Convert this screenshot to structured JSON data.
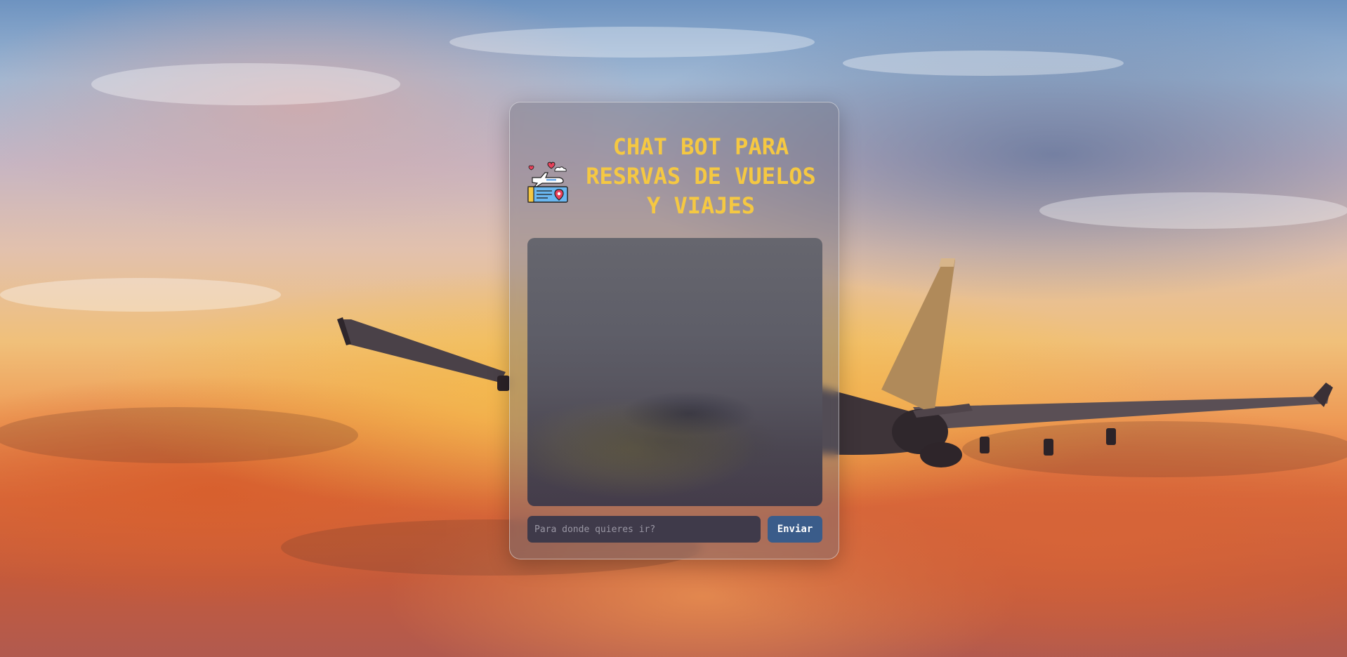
{
  "page": {
    "background": "sunset-sky-with-airplane",
    "accent_color": "#f5c842",
    "button_color": "#3a5c8a"
  },
  "header": {
    "logo_icon": "flight-ticket-icon",
    "title": "CHAT BOT PARA RESRVAS DE VUELOS Y VIAJES"
  },
  "chat": {
    "messages": []
  },
  "composer": {
    "placeholder": "Para donde quieres ir?",
    "value": "",
    "send_label": "Enviar"
  }
}
